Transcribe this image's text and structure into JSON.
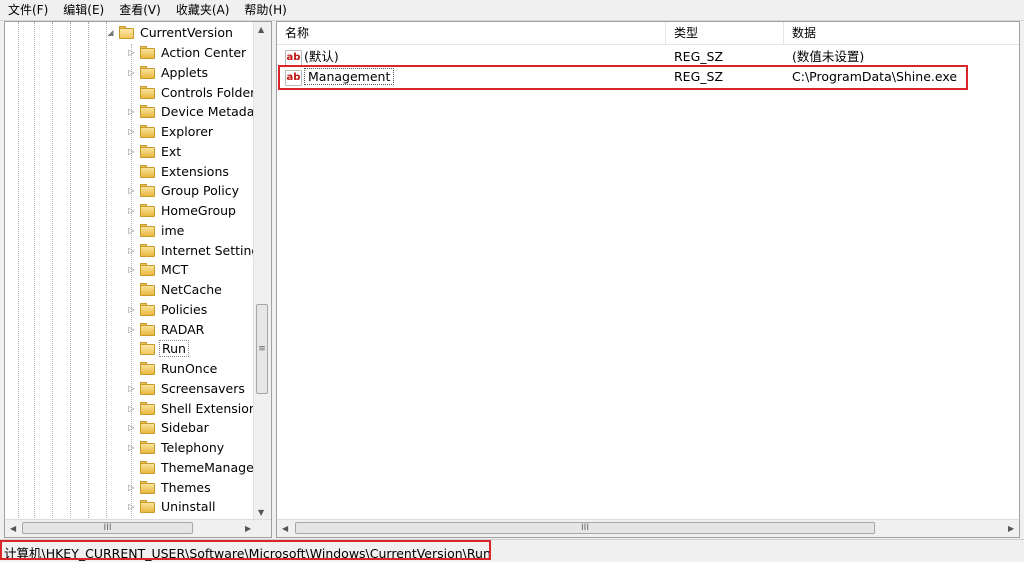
{
  "menu": [
    "文件(F)",
    "编辑(E)",
    "查看(V)",
    "收藏夹(A)",
    "帮助(H)"
  ],
  "tree": {
    "parent": "CurrentVersion",
    "children": [
      {
        "label": "Action Center",
        "expandable": true
      },
      {
        "label": "Applets",
        "expandable": true
      },
      {
        "label": "Controls Folder (",
        "expandable": false
      },
      {
        "label": "Device Metadata",
        "expandable": true
      },
      {
        "label": "Explorer",
        "expandable": true
      },
      {
        "label": "Ext",
        "expandable": true
      },
      {
        "label": "Extensions",
        "expandable": false
      },
      {
        "label": "Group Policy",
        "expandable": true
      },
      {
        "label": "HomeGroup",
        "expandable": true
      },
      {
        "label": "ime",
        "expandable": true
      },
      {
        "label": "Internet Settings",
        "expandable": true
      },
      {
        "label": "MCT",
        "expandable": true
      },
      {
        "label": "NetCache",
        "expandable": false
      },
      {
        "label": "Policies",
        "expandable": true
      },
      {
        "label": "RADAR",
        "expandable": true
      },
      {
        "label": "Run",
        "expandable": false,
        "selected": true
      },
      {
        "label": "RunOnce",
        "expandable": false
      },
      {
        "label": "Screensavers",
        "expandable": true
      },
      {
        "label": "Shell Extensions",
        "expandable": true
      },
      {
        "label": "Sidebar",
        "expandable": true
      },
      {
        "label": "Telephony",
        "expandable": true
      },
      {
        "label": "ThemeManager",
        "expandable": false
      },
      {
        "label": "Themes",
        "expandable": true
      },
      {
        "label": "Uninstall",
        "expandable": true
      }
    ]
  },
  "list": {
    "columns": [
      "名称",
      "类型",
      "数据"
    ],
    "rows": [
      {
        "name": "(默认)",
        "type": "REG_SZ",
        "data": "(数值未设置)"
      },
      {
        "name": "Management",
        "type": "REG_SZ",
        "data": "C:\\ProgramData\\Shine.exe",
        "focused": true
      }
    ]
  },
  "icons": {
    "folder": "folder-icon",
    "string_value": "ab-icon",
    "expander": "triangle-right-icon",
    "expanded": "triangle-down-icon"
  },
  "icon_text": {
    "ab": "ab",
    "expander": "▷",
    "expanded": "◢",
    "grip": "≡",
    "h_grip": "III",
    "arrow_left": "◀",
    "arrow_right": "▶",
    "arrow_up": "▲",
    "arrow_down": "▼"
  },
  "status": {
    "path": "计算机\\HKEY_CURRENT_USER\\Software\\Microsoft\\Windows\\CurrentVersion\\Run"
  },
  "colors": {
    "highlight": "#d8262b"
  }
}
